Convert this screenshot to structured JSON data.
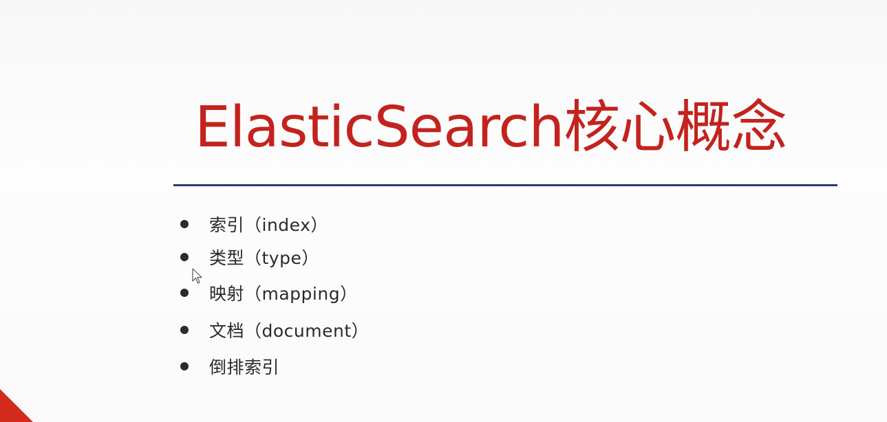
{
  "slide": {
    "title": "ElasticSearch核心概念",
    "title_color": "#c3231e",
    "rule_color": "#1f3f66",
    "accent_color": "#d42b1f",
    "bullets": [
      {
        "label": "索引（index）"
      },
      {
        "label": "类型（type）"
      },
      {
        "label": "映射（mapping）"
      },
      {
        "label": "文档（document）"
      },
      {
        "label": "倒排索引"
      }
    ]
  },
  "icons": {
    "cursor": "mouse-pointer-icon",
    "bullet": "bullet-dot-icon",
    "corner": "corner-triangle-accent"
  }
}
